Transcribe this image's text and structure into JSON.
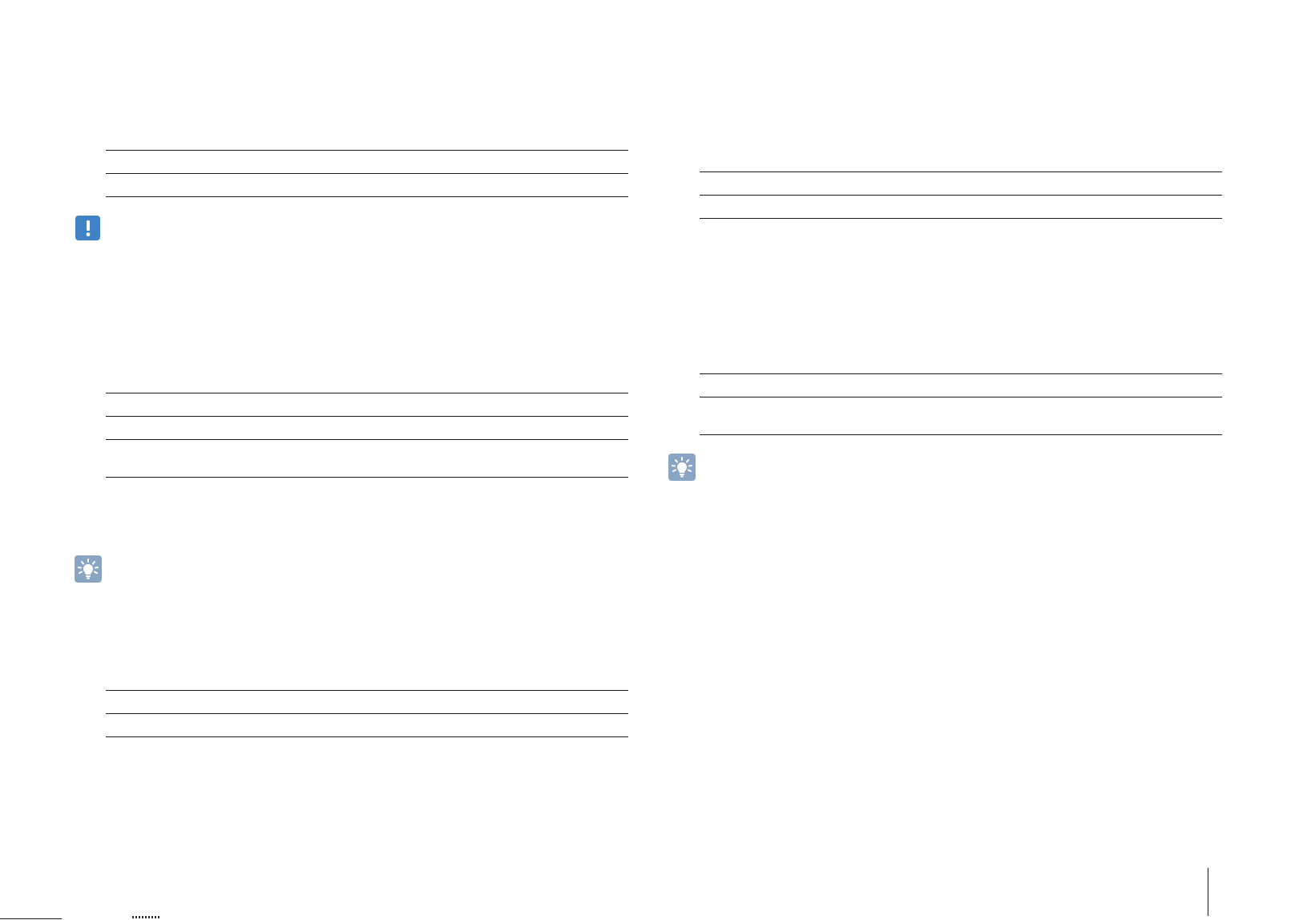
{
  "icons": {
    "note": "exclamation-icon",
    "tip": "lightbulb-icon"
  },
  "colors": {
    "note_icon_bg": "#3f82c6",
    "tip_icon_bg": "#8aa4c4",
    "rule": "#1a1a1a"
  }
}
